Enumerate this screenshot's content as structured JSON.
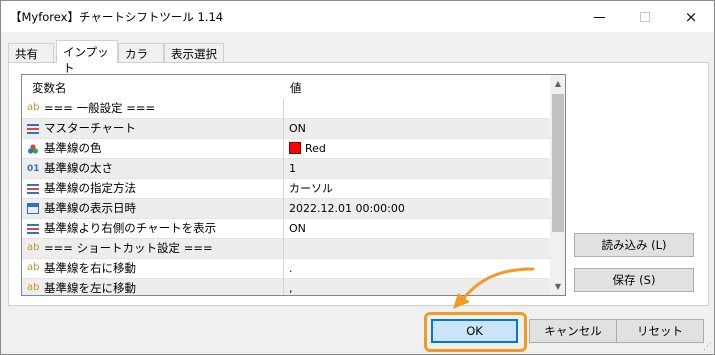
{
  "window": {
    "title": "【Myforex】チャートシフトツール 1.14",
    "controls": {
      "minimize": "minimize-icon",
      "maximize": "maximize-icon",
      "close": "×"
    }
  },
  "tabs": [
    {
      "label": "共有",
      "active": false
    },
    {
      "label": "インプット",
      "active": true
    },
    {
      "label": "カラー",
      "active": false
    },
    {
      "label": "表示選択",
      "active": false
    }
  ],
  "grid": {
    "headers": {
      "name": "変数名",
      "value": "値"
    },
    "rows": [
      {
        "icon": "ab",
        "name": "=== 一般設定 ===",
        "value": ""
      },
      {
        "icon": "list-icon",
        "name": "マスターチャート",
        "value": "ON"
      },
      {
        "icon": "color-palette-icon",
        "name": "基準線の色",
        "value": "Red",
        "swatch": "#ff0000"
      },
      {
        "icon": "01",
        "name": "基準線の太さ",
        "value": "1"
      },
      {
        "icon": "list-icon",
        "name": "基準線の指定方法",
        "value": "カーソル"
      },
      {
        "icon": "calendar-icon",
        "name": "基準線の表示日時",
        "value": "2022.12.01 00:00:00"
      },
      {
        "icon": "list-icon",
        "name": "基準線より右側のチャートを表示",
        "value": "ON"
      },
      {
        "icon": "ab",
        "name": "=== ショートカット設定 ===",
        "value": ""
      },
      {
        "icon": "ab",
        "name": "基準線を右に移動",
        "value": "."
      },
      {
        "icon": "ab",
        "name": "基準線を左に移動",
        "value": ","
      }
    ]
  },
  "buttons": {
    "load": "読み込み (L)",
    "save": "保存 (S)",
    "ok": "OK",
    "cancel": "キャンセル",
    "reset": "リセット"
  },
  "colors": {
    "highlight": "#f39a26",
    "ok_border": "#0078d7",
    "swatch_red": "#ff0000"
  }
}
